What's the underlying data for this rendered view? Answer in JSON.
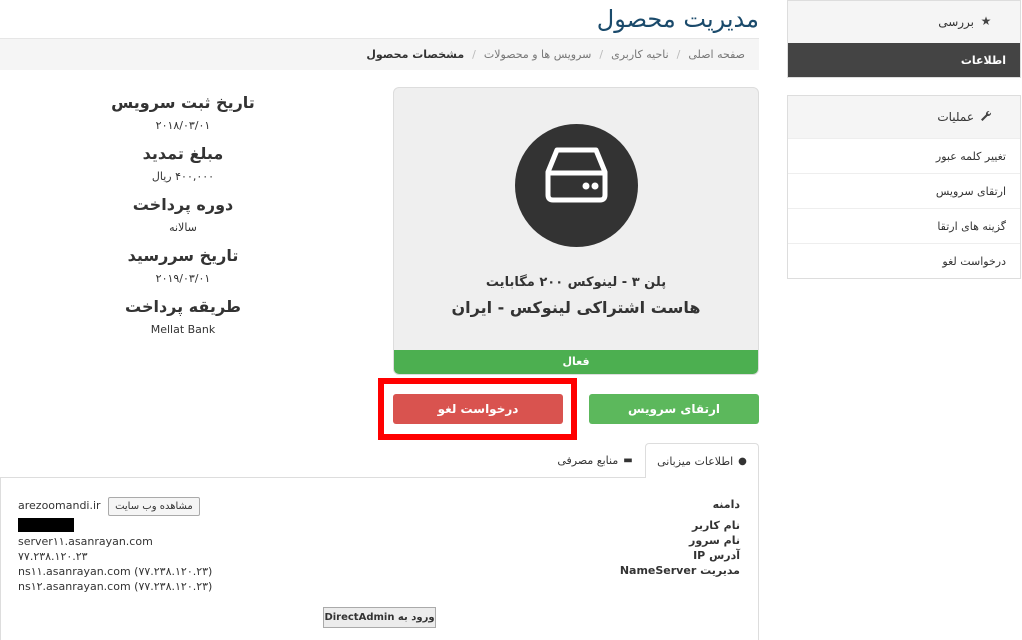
{
  "page": {
    "title": "مدیریت محصول"
  },
  "breadcrumb": [
    "صفحه اصلی",
    "ناحیه کاربری",
    "سرویس ها و محصولات",
    "مشخصات محصول"
  ],
  "sidebar": {
    "overview": {
      "title": "بررسی",
      "active_item": "اطلاعات"
    },
    "actions": {
      "title": "عملیات",
      "items": [
        "تغییر کلمه عبور",
        "ارتقای سرویس",
        "گزینه های ارتقا",
        "درخواست لغو"
      ]
    }
  },
  "details": [
    {
      "label": "تاریخ ثبت سرویس",
      "value": "۲۰۱۸/۰۳/۰۱"
    },
    {
      "label": "مبلغ تمدید",
      "value": "۴۰۰,۰۰۰ ریال"
    },
    {
      "label": "دوره پرداخت",
      "value": "سالانه"
    },
    {
      "label": "تاریخ سررسید",
      "value": "۲۰۱۹/۰۳/۰۱"
    },
    {
      "label": "طریقه پرداخت",
      "value": "Mellat Bank"
    }
  ],
  "product": {
    "plan": "پلن ۳ - لینوکس ۲۰۰ مگابایت",
    "name": "هاست اشتراکی لینوکس - ایران",
    "status": "فعال",
    "icon": "server-drive-icon"
  },
  "buttons": {
    "upgrade": "ارتقای سرویس",
    "cancel": "درخواست لغو",
    "directadmin": "ورود به DirectAdmin"
  },
  "tabs": {
    "hosting_info": "اطلاعات میزبانی",
    "resources": "منابع مصرفی"
  },
  "hosting": {
    "labels": [
      "دامنه",
      "نام کاربر",
      "نام سرور",
      "آدرس IP",
      "مدیریت NameServer"
    ],
    "domain": "arezoomandi.ir",
    "visit_site": "مشاهده وب سایت",
    "server": "server۱۱.asanrayan.com",
    "ip": "۷۷.۲۳۸.۱۲۰.۲۳",
    "ns1": "ns۱۱.asanrayan.com (۷۷.۲۳۸.۱۲۰.۲۳)",
    "ns2": "ns۱۲.asanrayan.com (۷۷.۲۳۸.۱۲۰.۲۳)"
  },
  "colors": {
    "title": "#1a4a6b",
    "success": "#5cb85c",
    "danger": "#d9534f",
    "highlight": "#ff0000",
    "dark": "#444444"
  }
}
